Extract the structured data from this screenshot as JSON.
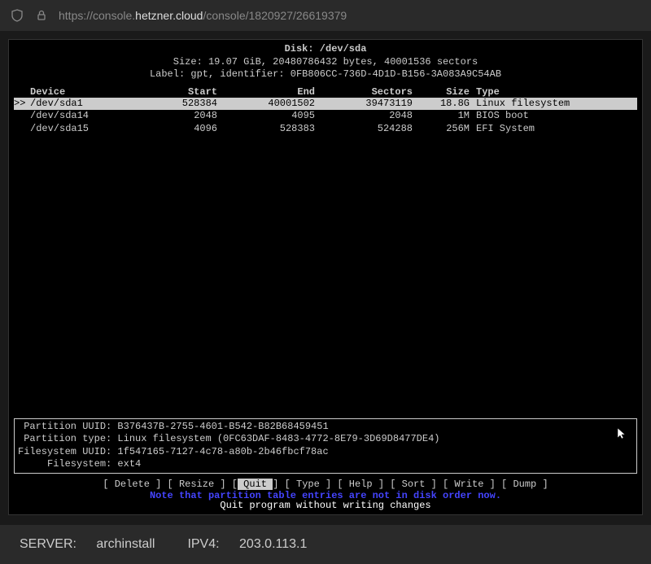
{
  "browser": {
    "url_prefix": "https://console.",
    "url_domain": "hetzner.cloud",
    "url_path": "/console/1820927/26619379"
  },
  "disk": {
    "title": "Disk: /dev/sda",
    "size_line": "Size: 19.07 GiB, 20480786432 bytes, 40001536 sectors",
    "label_line": "Label: gpt, identifier: 0FB806CC-736D-4D1D-B156-3A083A9C54AB"
  },
  "table": {
    "headers": {
      "device": "Device",
      "start": "Start",
      "end": "End",
      "sectors": "Sectors",
      "size": "Size",
      "type": "Type"
    },
    "rows": [
      {
        "prefix": ">>",
        "device": "/dev/sda1",
        "start": "528384",
        "end": "40001502",
        "sectors": "39473119",
        "size": "18.8G",
        "type": "Linux filesystem",
        "selected": true
      },
      {
        "prefix": "",
        "device": "/dev/sda14",
        "start": "2048",
        "end": "4095",
        "sectors": "2048",
        "size": "1M",
        "type": "BIOS boot",
        "selected": false
      },
      {
        "prefix": "",
        "device": "/dev/sda15",
        "start": "4096",
        "end": "528383",
        "sectors": "524288",
        "size": "256M",
        "type": "EFI System",
        "selected": false
      }
    ]
  },
  "partition_info": {
    "uuid_label": " Partition UUID: ",
    "uuid": "B376437B-2755-4601-B542-B82B68459451",
    "type_label": " Partition type: ",
    "type": "Linux filesystem (0FC63DAF-8483-4772-8E79-3D69D8477DE4)",
    "fs_uuid_label": "Filesystem UUID: ",
    "fs_uuid": "1f547165-7127-4c78-a80b-2b46fbcf78ac",
    "fs_label": "     Filesystem: ",
    "fs": "ext4"
  },
  "menu": {
    "items": [
      {
        "label": "Delete",
        "selected": false
      },
      {
        "label": "Resize",
        "selected": false
      },
      {
        "label": "Quit",
        "selected": true
      },
      {
        "label": "Type",
        "selected": false
      },
      {
        "label": "Help",
        "selected": false
      },
      {
        "label": "Sort",
        "selected": false
      },
      {
        "label": "Write",
        "selected": false
      },
      {
        "label": "Dump",
        "selected": false
      }
    ]
  },
  "warning": "Note that partition table entries are not in disk order now.",
  "hint": "Quit program without writing changes",
  "status": {
    "server_label": "SERVER:",
    "server_value": "archinstall",
    "ipv4_label": "IPV4:",
    "ipv4_value": "203.0.113.1"
  }
}
